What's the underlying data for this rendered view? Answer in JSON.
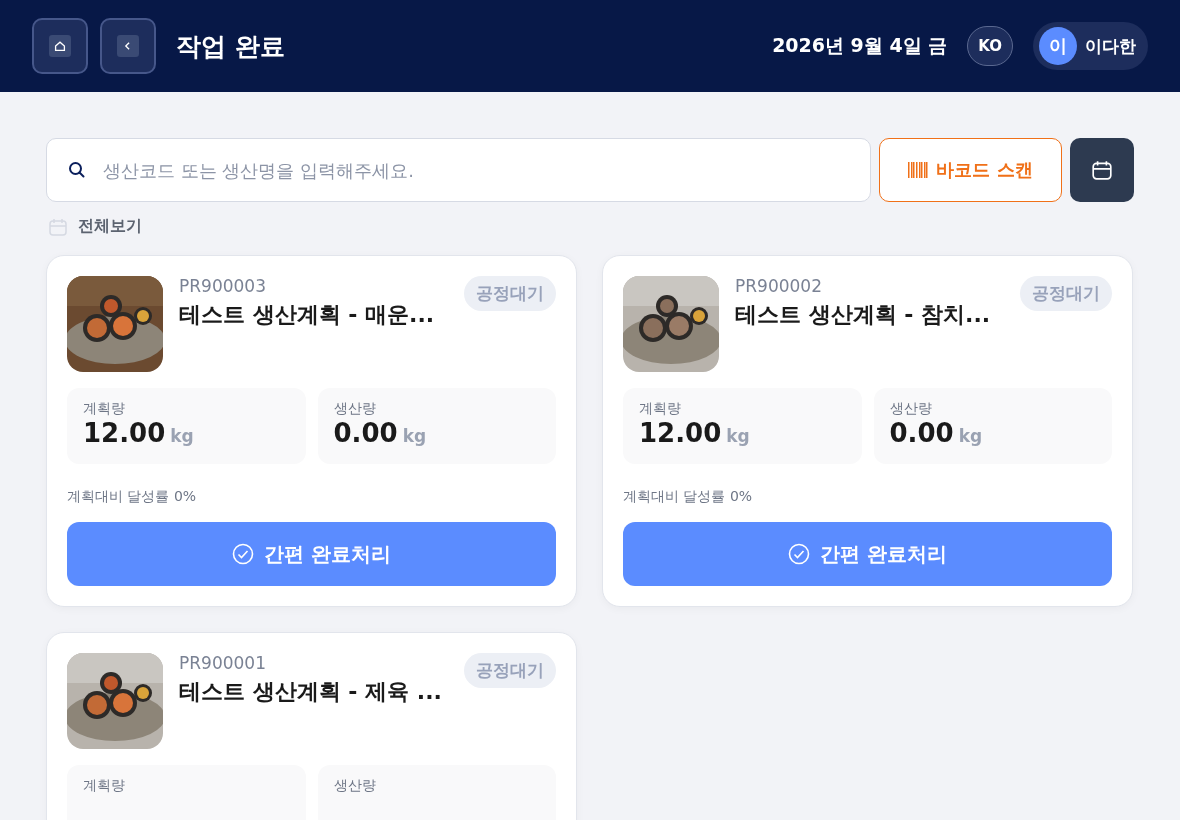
{
  "header": {
    "title": "작업 완료",
    "date": "2026년 9월 4일 금",
    "language": "KO",
    "user": {
      "initial": "이",
      "name": "이다한"
    }
  },
  "search": {
    "placeholder": "생산코드 또는 생산명을 입력해주세요."
  },
  "barcode_button": "바코드 스캔",
  "filter": {
    "label": "전체보기"
  },
  "cards": [
    {
      "code": "PR900003",
      "title": "테스트 생산계획 - 매운...",
      "status": "공정대기",
      "image": {
        "kind": "picture"
      },
      "stats": [
        {
          "label": "계획량",
          "value": "12.00",
          "unit": "kg"
        },
        {
          "label": "생산량",
          "value": "0.00",
          "unit": "kg"
        }
      ],
      "progress": "계획대비 달성률 0%",
      "action": "간편 완료처리"
    },
    {
      "code": "PR900002",
      "title": "테스트 생산계획 - 참치...",
      "status": "공정대기",
      "image": {
        "kind": "picture"
      },
      "stats": [
        {
          "label": "계획량",
          "value": "12.00",
          "unit": "kg"
        },
        {
          "label": "생산량",
          "value": "0.00",
          "unit": "kg"
        }
      ],
      "progress": "계획대비 달성률 0%",
      "action": "간편 완료처리"
    },
    {
      "code": "PR900001",
      "title": "테스트 생산계획 - 제육 ...",
      "status": "공정대기",
      "image": {
        "kind": "picture"
      },
      "stats": [
        {
          "label": "계획량"
        },
        {
          "label": "생산량"
        }
      ]
    }
  ]
}
